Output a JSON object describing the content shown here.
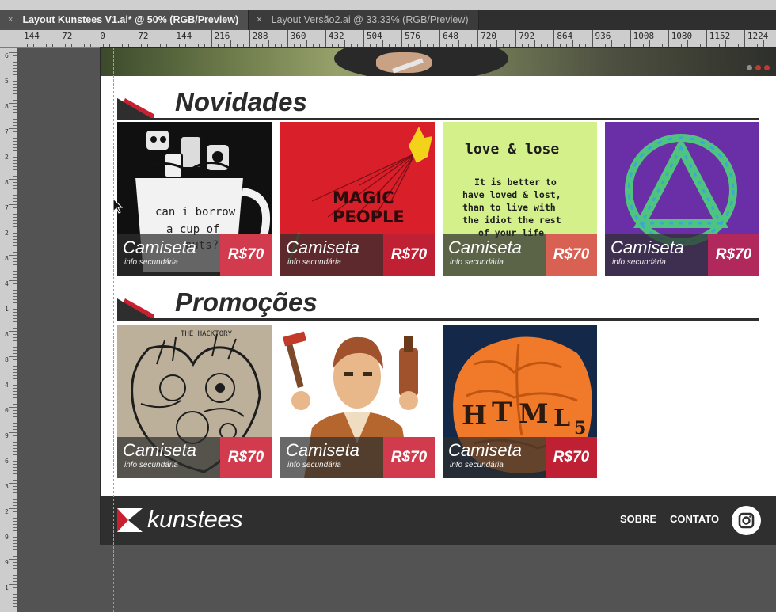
{
  "tabs": [
    {
      "label": "Layout Kunstees V1.ai* @ 50% (RGB/Preview)",
      "close": "×",
      "active": true
    },
    {
      "label": "Layout Versão2.ai @ 33.33% (RGB/Preview)",
      "close": "×",
      "active": false
    }
  ],
  "ruler": [
    "144",
    "72",
    "0",
    "72",
    "144",
    "216",
    "288",
    "360",
    "432",
    "504",
    "576",
    "648",
    "720",
    "792",
    "864",
    "936",
    "1008",
    "1080",
    "1152",
    "1224"
  ],
  "vruler": [
    "6",
    "5",
    "8",
    "7",
    "2",
    "8",
    "7",
    "2",
    "8",
    "4",
    "1",
    "8",
    "8",
    "4",
    "0",
    "9",
    "6",
    "3",
    "2",
    "9",
    "9",
    "1"
  ],
  "sections": {
    "novidades": "Novidades",
    "promocoes": "Promoções"
  },
  "products": {
    "novidades": [
      {
        "title": "Camiseta",
        "subtitle": "info secundária",
        "price": "R$70",
        "art_icon": "mug-robots-icon",
        "art_text": [
          "can i borrow",
          "a cup of",
          "nuts?"
        ],
        "price_color": "#d23b4e"
      },
      {
        "title": "Camiseta",
        "subtitle": "info secundária",
        "price": "R$70",
        "art_icon": "magic-people-icon",
        "art_text": [
          "MAGIC",
          "PEOPLE"
        ],
        "price_color": "#c02034"
      },
      {
        "title": "Camiseta",
        "subtitle": "info secundária",
        "price": "R$70",
        "art_icon": "love-lose-text-icon",
        "art_text": [
          "love & lose",
          "It is better to",
          "have loved & lost,",
          "than to live with",
          "the idiot the rest",
          "of your life."
        ],
        "price_color": "#d86153"
      },
      {
        "title": "Camiseta",
        "subtitle": "info secundária",
        "price": "R$70",
        "art_icon": "triangle-circle-logo-icon",
        "art_text": [],
        "price_color": "#b0285c"
      }
    ],
    "promocoes": [
      {
        "title": "Camiseta",
        "subtitle": "info secundária",
        "price": "R$70",
        "art_icon": "mechanical-heart-icon",
        "art_text": [
          "THE HACKTORY"
        ],
        "price_color": "#d23b4e"
      },
      {
        "title": "Camiseta",
        "subtitle": "info secundária",
        "price": "R$70",
        "art_icon": "boy-with-tools-icon",
        "art_text": [],
        "price_color": "#d23b4e"
      },
      {
        "title": "Camiseta",
        "subtitle": "info secundária",
        "price": "R$70",
        "art_icon": "html5-brain-icon",
        "art_text": [
          "H",
          "T",
          "M",
          "L",
          "5"
        ],
        "price_color": "#c02034"
      }
    ]
  },
  "footer": {
    "brand": "kunstees",
    "nav": [
      "SOBRE",
      "CONTATO"
    ],
    "social_icon": "instagram-icon"
  },
  "colors": {
    "accent_red": "#c8202f",
    "dark": "#2f2f2f",
    "chrome": "#535353"
  }
}
